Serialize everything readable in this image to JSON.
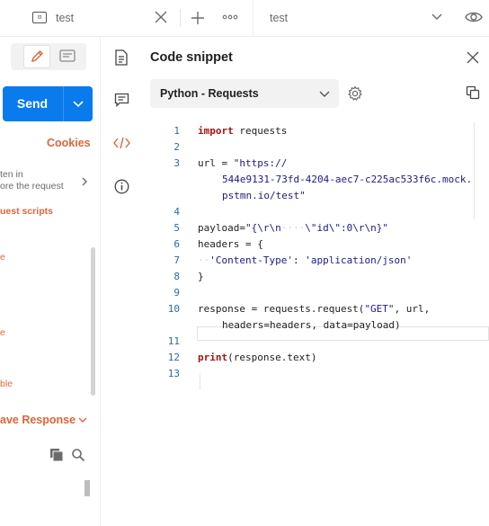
{
  "topbar": {
    "tab_title": "test",
    "env_label": "test"
  },
  "left": {
    "send_label": "Send",
    "cookies_label": "Cookies",
    "written_line1": "ten in",
    "written_line2": "ore the request",
    "scripts_label": "uest scripts",
    "frag_e1": "e",
    "frag_e2": "e",
    "frag_ble": "ble",
    "save_response_label": "ave Response"
  },
  "panel": {
    "title": "Code snippet",
    "language": "Python - Requests"
  },
  "code": {
    "line_numbers": [
      "1",
      "2",
      "3",
      "4",
      "5",
      "6",
      "7",
      "8",
      "9",
      "10",
      "11",
      "12",
      "13"
    ],
    "l1_kw": "import",
    "l1_rest": " requests",
    "l3_a": "url = ",
    "l3_b": "\"https://",
    "l3c": "544e9131-73fd-4204-aec7-c225ac533f6c.mock.",
    "l3d": "pstmn.io/test\"",
    "l5_a": "payload=",
    "l5_b": "\"{\\r\\n",
    "l5_ws": "····",
    "l5_c": "\\\"id\\\":0\\r\\n}\"",
    "l6": "headers = {",
    "l7_ws": "··",
    "l7_a": "'Content-Type'",
    "l7_b": ": ",
    "l7_c": "'application/json'",
    "l8": "}",
    "l10_a": "response = requests.request(",
    "l10_b": "\"GET\"",
    "l10_c": ", url,",
    "l10d": "headers=headers, data=payload)",
    "l12_kw": "print",
    "l12_rest": "(response.text)"
  },
  "colors": {
    "accent_blue": "#097bed",
    "accent_orange": "#e0653a"
  },
  "icons": [
    "tab-request-icon",
    "close-icon",
    "plus-icon",
    "more-icon",
    "chevron-down-icon",
    "eye-icon",
    "edit-icon",
    "comment-icon",
    "document-icon",
    "code-icon",
    "info-icon",
    "settings-icon",
    "copy-icon",
    "search-icon"
  ]
}
